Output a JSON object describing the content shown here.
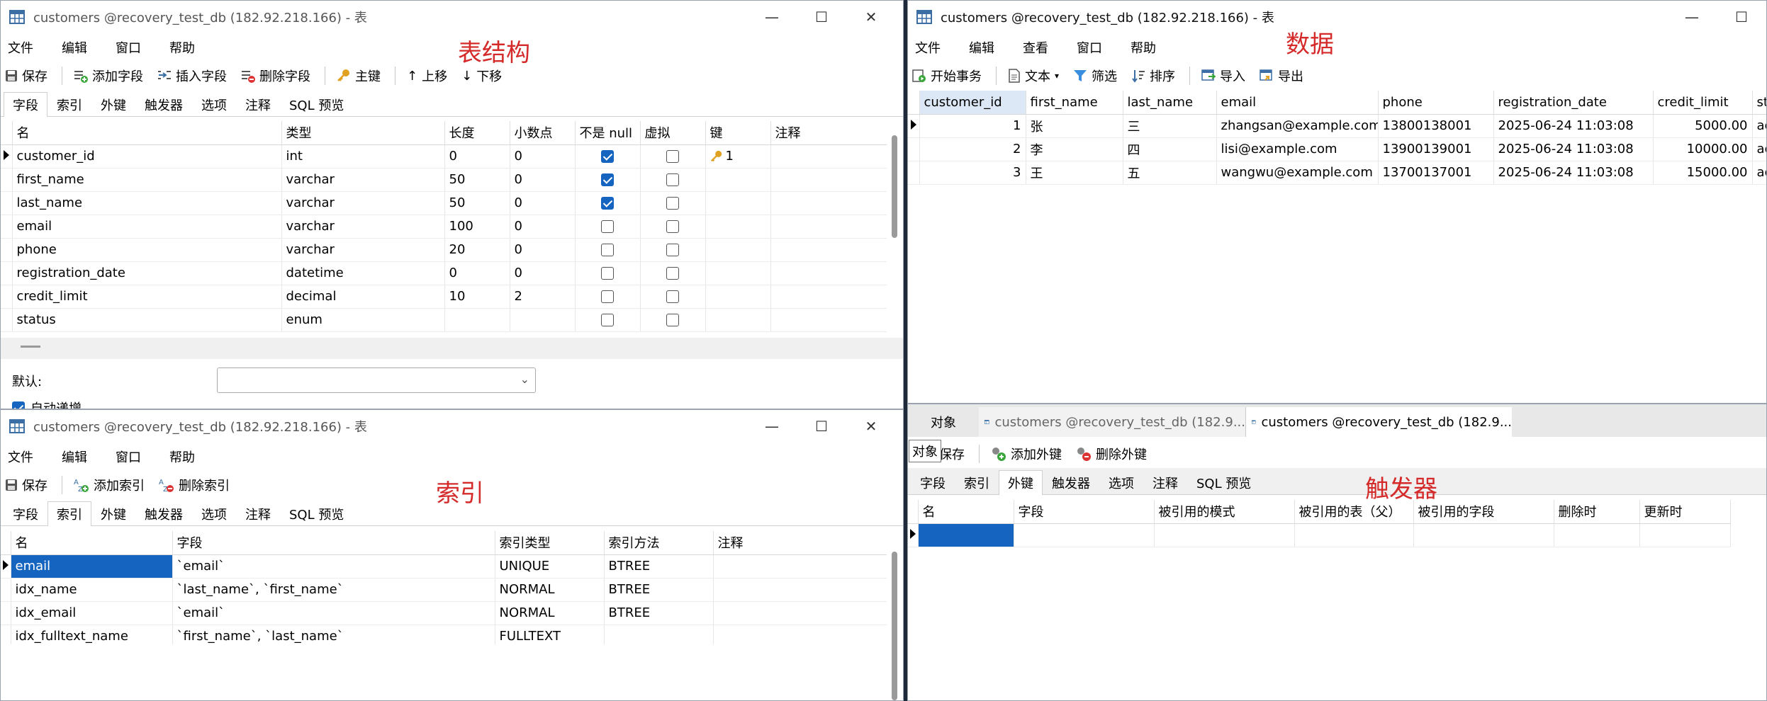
{
  "windows": {
    "structure": {
      "title": "customers @recovery_test_db (182.92.218.166) - 表",
      "menu": [
        "文件",
        "编辑",
        "窗口",
        "帮助"
      ],
      "toolbar": {
        "save": "保存",
        "add_field": "添加字段",
        "insert_field": "插入字段",
        "delete_field": "删除字段",
        "primary_key": "主键",
        "move_up": "上移",
        "move_down": "下移"
      },
      "tabs": [
        "字段",
        "索引",
        "外键",
        "触发器",
        "选项",
        "注释",
        "SQL 预览"
      ],
      "label": "表结构",
      "headers": [
        "名",
        "类型",
        "长度",
        "小数点",
        "不是 null",
        "虚拟",
        "键",
        "注释"
      ],
      "rows": [
        {
          "name": "customer_id",
          "type": "int",
          "length": "0",
          "decimals": "0",
          "notnull": true,
          "virtual": false,
          "key": "1"
        },
        {
          "name": "first_name",
          "type": "varchar",
          "length": "50",
          "decimals": "0",
          "notnull": true,
          "virtual": false,
          "key": ""
        },
        {
          "name": "last_name",
          "type": "varchar",
          "length": "50",
          "decimals": "0",
          "notnull": true,
          "virtual": false,
          "key": ""
        },
        {
          "name": "email",
          "type": "varchar",
          "length": "100",
          "decimals": "0",
          "notnull": false,
          "virtual": false,
          "key": ""
        },
        {
          "name": "phone",
          "type": "varchar",
          "length": "20",
          "decimals": "0",
          "notnull": false,
          "virtual": false,
          "key": ""
        },
        {
          "name": "registration_date",
          "type": "datetime",
          "length": "0",
          "decimals": "0",
          "notnull": false,
          "virtual": false,
          "key": ""
        },
        {
          "name": "credit_limit",
          "type": "decimal",
          "length": "10",
          "decimals": "2",
          "notnull": false,
          "virtual": false,
          "key": ""
        },
        {
          "name": "status",
          "type": "enum",
          "length": "",
          "decimals": "",
          "notnull": false,
          "virtual": false,
          "key": ""
        }
      ],
      "default_label": "默认:",
      "auto_increment_label": "自动递增"
    },
    "data": {
      "title": "customers @recovery_test_db (182.92.218.166) - 表",
      "menu": [
        "文件",
        "编辑",
        "查看",
        "窗口",
        "帮助"
      ],
      "toolbar": {
        "begin_tx": "开始事务",
        "text": "文本",
        "filter": "筛选",
        "sort": "排序",
        "import": "导入",
        "export": "导出"
      },
      "label": "数据",
      "headers": [
        "customer_id",
        "first_name",
        "last_name",
        "email",
        "phone",
        "registration_date",
        "credit_limit",
        "st"
      ],
      "rows": [
        [
          "1",
          "张",
          "三",
          "zhangsan@example.com",
          "13800138001",
          "2025-06-24 11:03:08",
          "5000.00",
          "ac"
        ],
        [
          "2",
          "李",
          "四",
          "lisi@example.com",
          "13900139001",
          "2025-06-24 11:03:08",
          "10000.00",
          "ac"
        ],
        [
          "3",
          "王",
          "五",
          "wangwu@example.com",
          "13700137001",
          "2025-06-24 11:03:08",
          "15000.00",
          "ac"
        ]
      ]
    },
    "index": {
      "title": "customers @recovery_test_db (182.92.218.166) - 表",
      "menu": [
        "文件",
        "编辑",
        "窗口",
        "帮助"
      ],
      "toolbar": {
        "save": "保存",
        "add_index": "添加索引",
        "delete_index": "删除索引"
      },
      "tabs": [
        "字段",
        "索引",
        "外键",
        "触发器",
        "选项",
        "注释",
        "SQL 预览"
      ],
      "label": "索引",
      "headers": [
        "名",
        "字段",
        "索引类型",
        "索引方法",
        "注释"
      ],
      "rows": [
        [
          "email",
          "`email`",
          "UNIQUE",
          "BTREE",
          ""
        ],
        [
          "idx_name",
          "`last_name`, `first_name`",
          "NORMAL",
          "BTREE",
          ""
        ],
        [
          "idx_email",
          "`email`",
          "NORMAL",
          "BTREE",
          ""
        ],
        [
          "idx_fulltext_name",
          "`first_name`, `last_name`",
          "FULLTEXT",
          "",
          ""
        ]
      ]
    },
    "fk": {
      "doc_tabs": [
        "对象",
        "customers @recovery_test_db (182.9...",
        "customers @recovery_test_db (182.9..."
      ],
      "tooltip": "对象",
      "toolbar": {
        "save": "保存",
        "add_fk": "添加外键",
        "delete_fk": "删除外键"
      },
      "tabs": [
        "字段",
        "索引",
        "外键",
        "触发器",
        "选项",
        "注释",
        "SQL 预览"
      ],
      "label": "触发器",
      "headers": [
        "名",
        "字段",
        "被引用的模式",
        "被引用的表（父）",
        "被引用的字段",
        "删除时",
        "更新时"
      ]
    }
  }
}
